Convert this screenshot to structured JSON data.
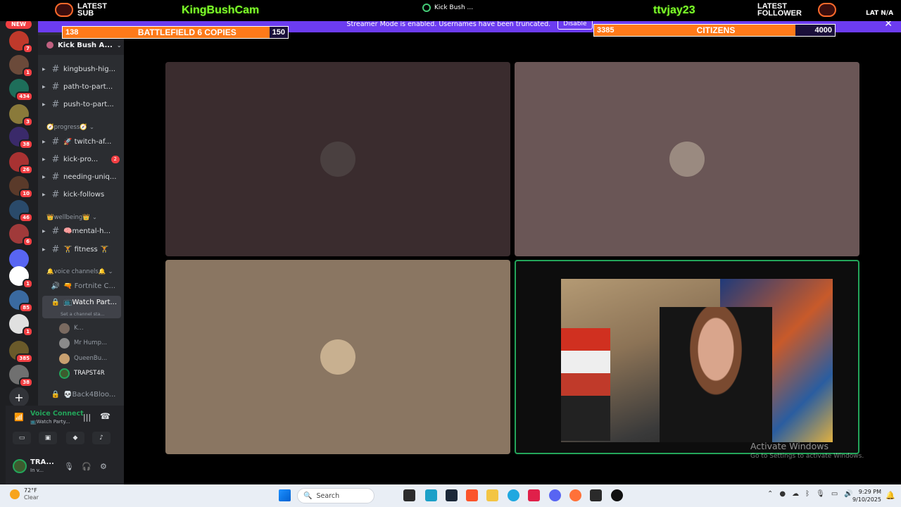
{
  "overlay": {
    "latest_sub_label": "LATEST SUB",
    "latest_sub_name": "KingBushCam",
    "center_tab": "Kick Bush ...",
    "latest_follower_label": "LATEST FOLLOWER",
    "latest_follower_name": "ttvjay23",
    "lat_text": "LAT N/A"
  },
  "goals": {
    "left": {
      "current": "138",
      "title": "BATTLEFIELD 6 COPIES",
      "max": "150",
      "progress": 0.92
    },
    "right": {
      "current": "3385",
      "title": "CITIZENS",
      "max": "4000",
      "progress": 0.85
    }
  },
  "streamer_bar": {
    "message": "Streamer Mode is enabled. Usernames have been truncated.",
    "disable_label": "Disable",
    "close": "✕"
  },
  "rail": {
    "new_badge": "NEW",
    "items": [
      {
        "color": "#c0392b",
        "badge": "7"
      },
      {
        "color": "#6b4a3a",
        "badge": "1"
      },
      {
        "color": "#1e6e5a",
        "badge": "434"
      },
      {
        "color": "#8a7a3a",
        "badge": "3"
      },
      {
        "color": "#3a2a6a",
        "badge": "38"
      },
      {
        "color": "#a83232",
        "badge": "26"
      },
      {
        "color": "#5a3a2a",
        "badge": "10"
      },
      {
        "color": "#2a4a6a",
        "badge": "46"
      },
      {
        "color": "#a03a3a",
        "badge": "6"
      },
      {
        "color": "#5865f2",
        "badge": ""
      },
      {
        "color": "#ffffff",
        "badge": "1"
      },
      {
        "color": "#3a6aa0",
        "badge": "85"
      },
      {
        "color": "#e0e0e0",
        "badge": "1"
      },
      {
        "color": "#6a5a2a",
        "badge": "385"
      },
      {
        "color": "#707070",
        "badge": "38"
      }
    ],
    "add_label": "+"
  },
  "sidebar": {
    "server_name": "Kick Bush A...",
    "channels_top": [
      {
        "label": "kingbush-hig...",
        "badge": ""
      },
      {
        "label": "path-to-part...",
        "badge": ""
      },
      {
        "label": "push-to-part...",
        "badge": ""
      }
    ],
    "cat_progress": "🧭progress🧭",
    "channels_progress": [
      {
        "label": "🚀 twitch-af...",
        "badge": ""
      },
      {
        "label": "kick-pro...",
        "badge": "2"
      },
      {
        "label": "needing-uniq...",
        "badge": ""
      },
      {
        "label": "kick-follows",
        "badge": ""
      }
    ],
    "cat_wellbeing": "👑wellbeing👑",
    "channels_wellbeing": [
      {
        "label": "🧠mental-h...",
        "badge": ""
      },
      {
        "label": "🏋 fitness 🏋",
        "badge": ""
      }
    ],
    "cat_voice": "🔔voice channels🔔",
    "voice_channels": [
      {
        "label": "🔫 Fortnite C..."
      },
      {
        "label": "📺Watch Part..."
      }
    ],
    "channel_status": "Set a channel sta...",
    "voice_users": [
      "K...",
      "Mr Hump...",
      "QueenBu...",
      "TRAPST4R"
    ],
    "locked_channel": "💀Back4Bloo..."
  },
  "user_panel": {
    "voice_status": "Voice Connect",
    "voice_channel": "📺Watch Party...",
    "username": "TRA...",
    "user_sub": "In v..."
  },
  "stage": {
    "tiles": [
      {
        "color": "#3a2c2e",
        "avatar": "#4a4040"
      },
      {
        "color": "#6a5656",
        "avatar": "#9a8a80"
      },
      {
        "color": "#8a7662",
        "avatar": "#c8b090"
      }
    ]
  },
  "watermark": {
    "title": "Activate Windows",
    "sub": "Go to Settings to activate Windows."
  },
  "taskbar": {
    "temp": "72°F",
    "weather": "Clear",
    "search_placeholder": "Search",
    "time": "9:29 PM",
    "date": "9/10/2025"
  }
}
